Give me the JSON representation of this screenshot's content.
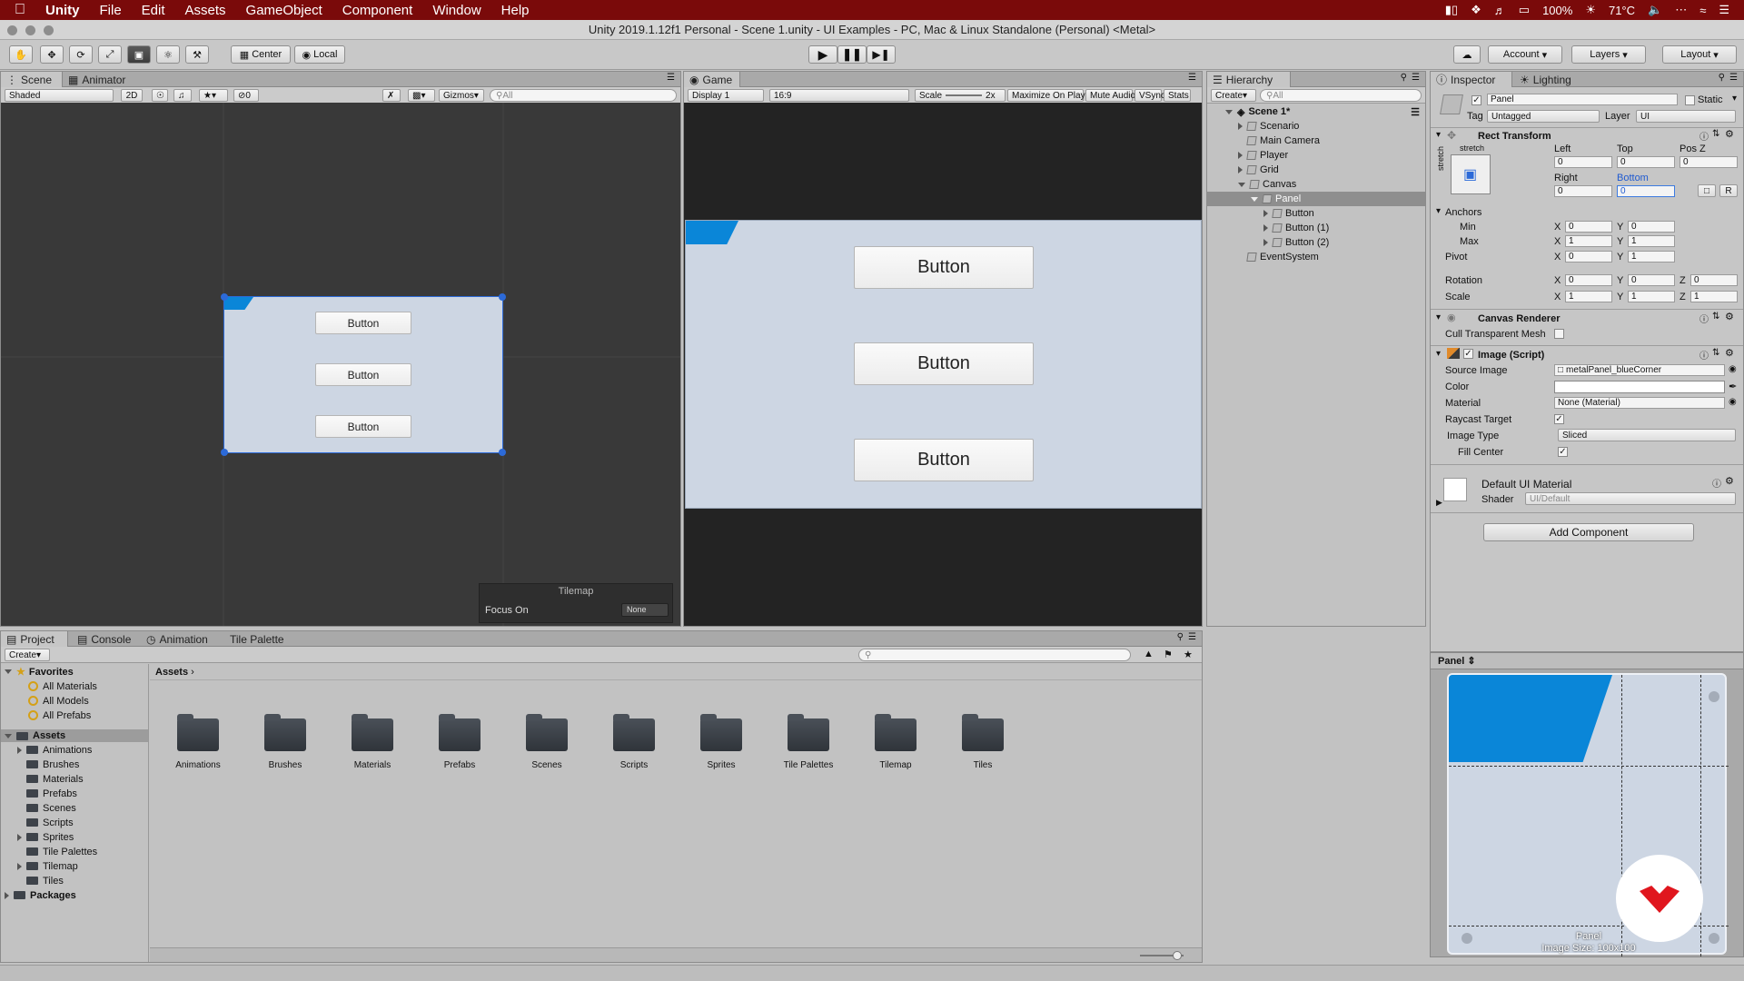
{
  "menubar": {
    "app_name": "Unity",
    "items": [
      "File",
      "Edit",
      "Assets",
      "GameObject",
      "Component",
      "Window",
      "Help"
    ],
    "battery": "100%",
    "temperature": "71°C"
  },
  "window_title": "Unity 2019.1.12f1 Personal - Scene 1.unity - UI Examples - PC, Mac & Linux Standalone (Personal) <Metal>",
  "toolbar": {
    "pivot_label": "Center",
    "space_label": "Local",
    "account_label": "Account",
    "layers_label": "Layers",
    "layout_label": "Layout"
  },
  "scene_panel": {
    "tabs": [
      "Scene",
      "Animator"
    ],
    "shading_mode": "Shaded",
    "mode_2d": "2D",
    "fx_count": "0",
    "gizmos_label": "Gizmos",
    "search_placeholder": "All",
    "buttons": [
      "Button",
      "Button",
      "Button"
    ],
    "tilemap_overlay": {
      "title": "Tilemap",
      "focus_label": "Focus On",
      "focus_value": "None"
    }
  },
  "game_panel": {
    "tab": "Game",
    "display": "Display 1",
    "aspect": "16:9",
    "scale_label": "Scale",
    "scale_value": "2x",
    "maximize_label": "Maximize On Play",
    "mute_label": "Mute Audio",
    "vsync_label": "VSync",
    "stats_label": "Stats",
    "buttons": [
      "Button",
      "Button",
      "Button"
    ]
  },
  "hierarchy": {
    "tab": "Hierarchy",
    "create_label": "Create",
    "search_placeholder": "All",
    "scene_name": "Scene 1*",
    "items": [
      "Scenario",
      "Main Camera",
      "Player",
      "Grid",
      "Canvas",
      "Panel",
      "Button",
      "Button (1)",
      "Button (2)",
      "EventSystem"
    ]
  },
  "inspector": {
    "tabs": [
      "Inspector",
      "Lighting"
    ],
    "object_name": "Panel",
    "static_label": "Static",
    "tag_label": "Tag",
    "tag_value": "Untagged",
    "layer_label": "Layer",
    "layer_value": "UI",
    "rect_transform": {
      "title": "Rect Transform",
      "stretch_label": "stretch",
      "left_label": "Left",
      "top_label": "Top",
      "posz_label": "Pos Z",
      "left": "0",
      "top": "0",
      "posz": "0",
      "right_label": "Right",
      "bottom_label": "Bottom",
      "right": "0",
      "bottom": "0",
      "reset_label": "R",
      "anchors_label": "Anchors",
      "min_label": "Min",
      "max_label": "Max",
      "pivot_label": "Pivot",
      "rotation_label": "Rotation",
      "scale_label": "Scale",
      "x_label": "X",
      "y_label": "Y",
      "z_label": "Z",
      "min_x": "0",
      "min_y": "0",
      "max_x": "1",
      "max_y": "1",
      "pivot_x": "0",
      "pivot_y": "1",
      "rot_x": "0",
      "rot_y": "0",
      "rot_z": "0",
      "scale_x": "1",
      "scale_y": "1",
      "scale_z": "1"
    },
    "canvas_renderer": {
      "title": "Canvas Renderer",
      "cull_label": "Cull Transparent Mesh"
    },
    "image": {
      "title": "Image (Script)",
      "source_label": "Source Image",
      "source_value": "metalPanel_blueCorner",
      "color_label": "Color",
      "material_label": "Material",
      "material_value": "None (Material)",
      "raycast_label": "Raycast Target",
      "type_label": "Image Type",
      "type_value": "Sliced",
      "fill_label": "Fill Center"
    },
    "material": {
      "title": "Default UI Material",
      "shader_label": "Shader",
      "shader_value": "UI/Default"
    },
    "add_component_label": "Add Component",
    "preview_title": "Panel",
    "preview_caption_name": "Panel",
    "preview_caption_size": "Image Size: 100x100"
  },
  "project_panel": {
    "tabs": [
      "Project",
      "Console",
      "Animation",
      "Tile Palette"
    ],
    "create_label": "Create",
    "favorites_label": "Favorites",
    "favorites": [
      "All Materials",
      "All Models",
      "All Prefabs"
    ],
    "assets_label": "Assets",
    "asset_tree": [
      "Animations",
      "Brushes",
      "Materials",
      "Prefabs",
      "Scenes",
      "Scripts",
      "Sprites",
      "Tile Palettes",
      "Tilemap",
      "Tiles"
    ],
    "packages_label": "Packages",
    "breadcrumb": "Assets",
    "folders": [
      "Animations",
      "Brushes",
      "Materials",
      "Prefabs",
      "Scenes",
      "Scripts",
      "Sprites",
      "Tile Palettes",
      "Tilemap",
      "Tiles"
    ]
  },
  "colors": {
    "accent_blue": "#0a86d8",
    "menubar": "#7a0a0a",
    "panel_bg": "#c2c2c2"
  }
}
